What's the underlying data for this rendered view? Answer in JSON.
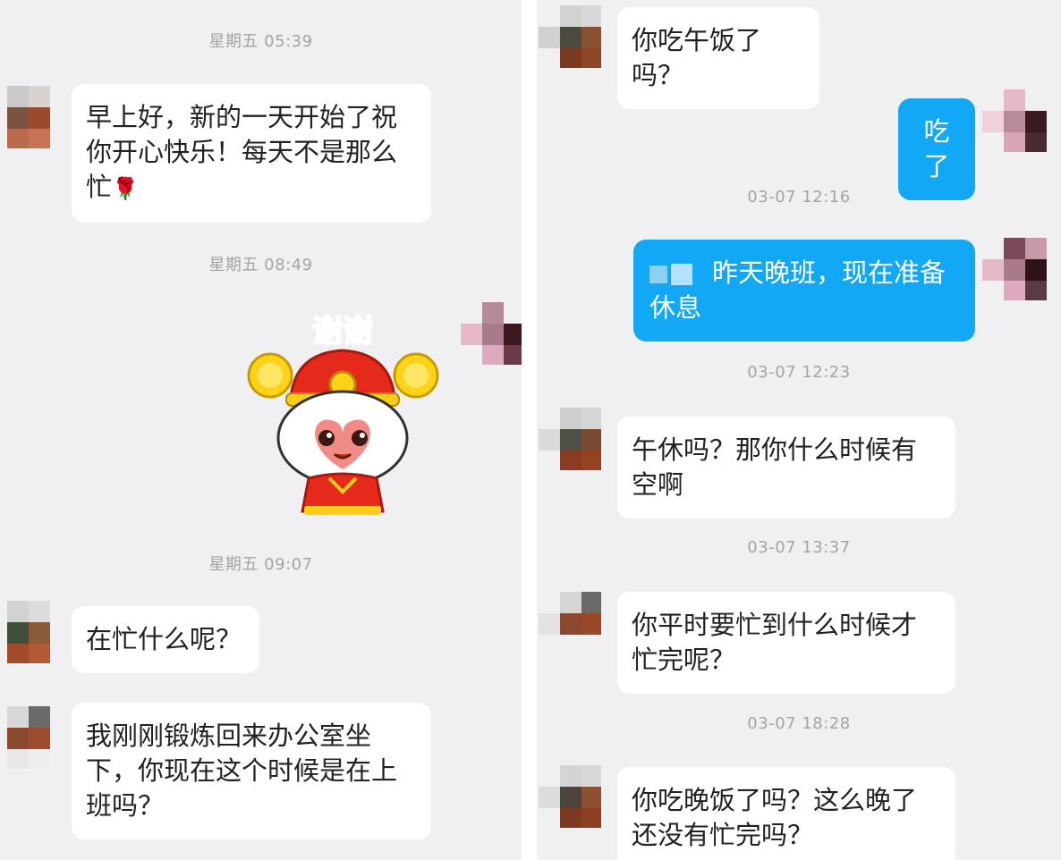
{
  "left": {
    "timestamps": [
      "星期五 05:39",
      "星期五 08:49",
      "星期五 09:07"
    ],
    "messages": [
      {
        "text": "早上好，新的一天开始了祝你开心快乐！每天不是那么忙",
        "emoji": "🌹"
      },
      {
        "text": "在忙什么呢？"
      },
      {
        "text": "我刚刚锻炼回来办公室坐下，你现在这个时候是在上班吗？"
      }
    ],
    "sticker_text": "谢谢"
  },
  "right": {
    "timestamps": [
      "03-07 12:16",
      "03-07 12:23",
      "03-07 13:37",
      "03-07 18:28"
    ],
    "messages": [
      {
        "text": "你吃午饭了吗？"
      },
      {
        "text": "吃了"
      },
      {
        "text": "昨天晚班，现在准备休息"
      },
      {
        "text": "午休吗？那你什么时候有空啊"
      },
      {
        "text": "你平时要忙到什么时候才忙完呢？"
      },
      {
        "text": "你吃晚饭了吗？这么晚了还没有忙完吗？"
      }
    ]
  },
  "colors": {
    "background": "#f0f0f3",
    "received_bubble": "#ffffff",
    "sent_bubble": "#13a8f5",
    "timestamp": "#a3a3a8"
  },
  "icons": [
    "avatar-icon",
    "rose-emoji",
    "thanks-sticker"
  ]
}
